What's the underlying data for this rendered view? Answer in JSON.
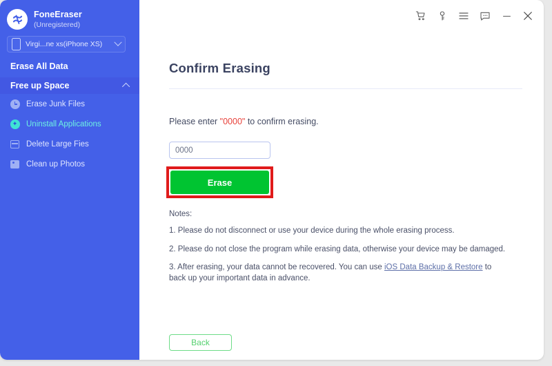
{
  "brand": {
    "name": "FoneEraser",
    "status": "(Unregistered)",
    "logo_icon": "fone-eraser-logo-icon"
  },
  "device_selector": {
    "label": "Virgi...ne xs(iPhone XS)",
    "icon": "phone-icon",
    "chevron": "chevron-down-icon"
  },
  "sidebar": {
    "top_item": "Erase All Data",
    "group": {
      "label": "Free up Space",
      "chevron": "chevron-up-icon",
      "items": [
        {
          "label": "Erase Junk Files",
          "icon": "clock-icon",
          "active": false
        },
        {
          "label": "Uninstall Applications",
          "icon": "app-star-icon",
          "active": true
        },
        {
          "label": "Delete Large Fies",
          "icon": "rows-icon",
          "active": false
        },
        {
          "label": "Clean up Photos",
          "icon": "photo-icon",
          "active": false
        }
      ]
    }
  },
  "window_controls": [
    {
      "name": "cart-icon",
      "title": "Buy"
    },
    {
      "name": "key-icon",
      "title": "Register"
    },
    {
      "name": "menu-icon",
      "title": "Menu"
    },
    {
      "name": "chat-icon",
      "title": "Feedback"
    },
    {
      "name": "minimize-icon",
      "title": "Minimize"
    },
    {
      "name": "close-icon",
      "title": "Close"
    }
  ],
  "main": {
    "title": "Confirm Erasing",
    "prompt_prefix": "Please enter ",
    "prompt_code": "\"0000\"",
    "prompt_suffix": " to confirm erasing.",
    "input_value": "0000",
    "input_placeholder": "0000",
    "erase_label": "Erase",
    "back_label": "Back",
    "notes_heading": "Notes:",
    "note1": "1. Please do not disconnect or use your device during the whole erasing process.",
    "note2": "2. Please do not close the program while erasing data, otherwise your device may be damaged.",
    "note3_prefix": "3. After erasing, your data cannot be recovered. You can use ",
    "note3_link": "iOS Data Backup & Restore",
    "note3_suffix": " to back up your important data in advance."
  },
  "colors": {
    "sidebar_blue": "#4460e8",
    "group_blue": "#4258e3",
    "active_cyan": "#6ef0e2",
    "erase_green": "#00c431",
    "highlight_red": "#e01b1b",
    "code_red": "#e8413a",
    "back_green": "#54d06e"
  }
}
